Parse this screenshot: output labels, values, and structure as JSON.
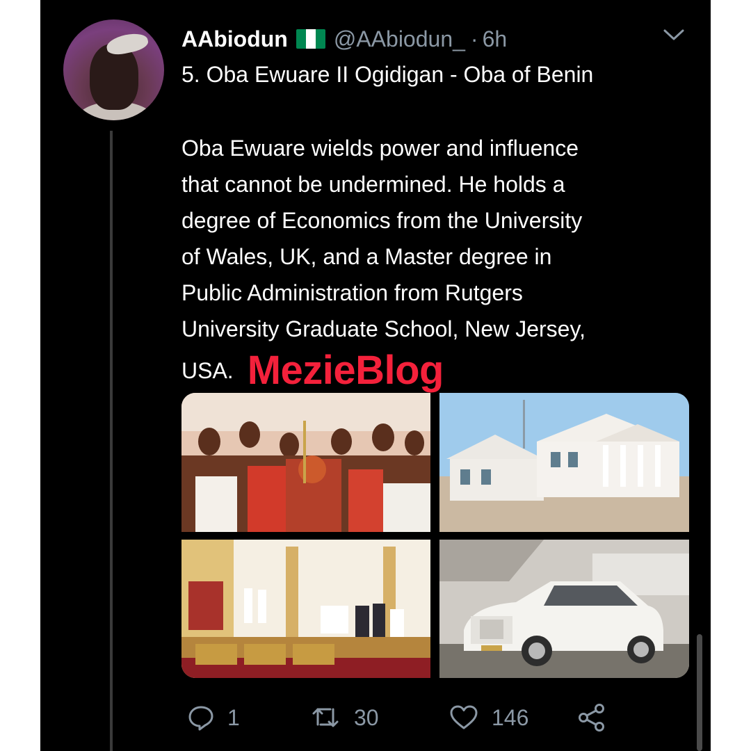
{
  "tweet": {
    "display_name": "AAbiodun",
    "flag_icon": "nigeria-flag-icon",
    "flag_colors": [
      "#008751",
      "#ffffff",
      "#008751"
    ],
    "handle": "@AAbiodun_",
    "separator": "·",
    "time": "6h",
    "title": "5. Oba Ewuare II Ogidigan - Oba of Benin",
    "body_lines": [
      "Oba Ewuare wields power and influence",
      "that cannot be undermined. He holds a",
      "degree of Economics from the University",
      "of Wales, UK, and a Master degree in",
      "Public Administration from Rutgers",
      "University Graduate School, New Jersey,",
      "USA."
    ],
    "watermark": "MezieBlog",
    "watermark_color": "#f4213b"
  },
  "actions": {
    "reply": {
      "icon": "reply-icon",
      "count": "1"
    },
    "retweet": {
      "icon": "retweet-icon",
      "count": "30"
    },
    "like": {
      "icon": "heart-icon",
      "count": "146"
    },
    "share": {
      "icon": "share-icon"
    }
  },
  "colors": {
    "background": "#000000",
    "text": "#ffffff",
    "muted": "#8b98a5"
  }
}
